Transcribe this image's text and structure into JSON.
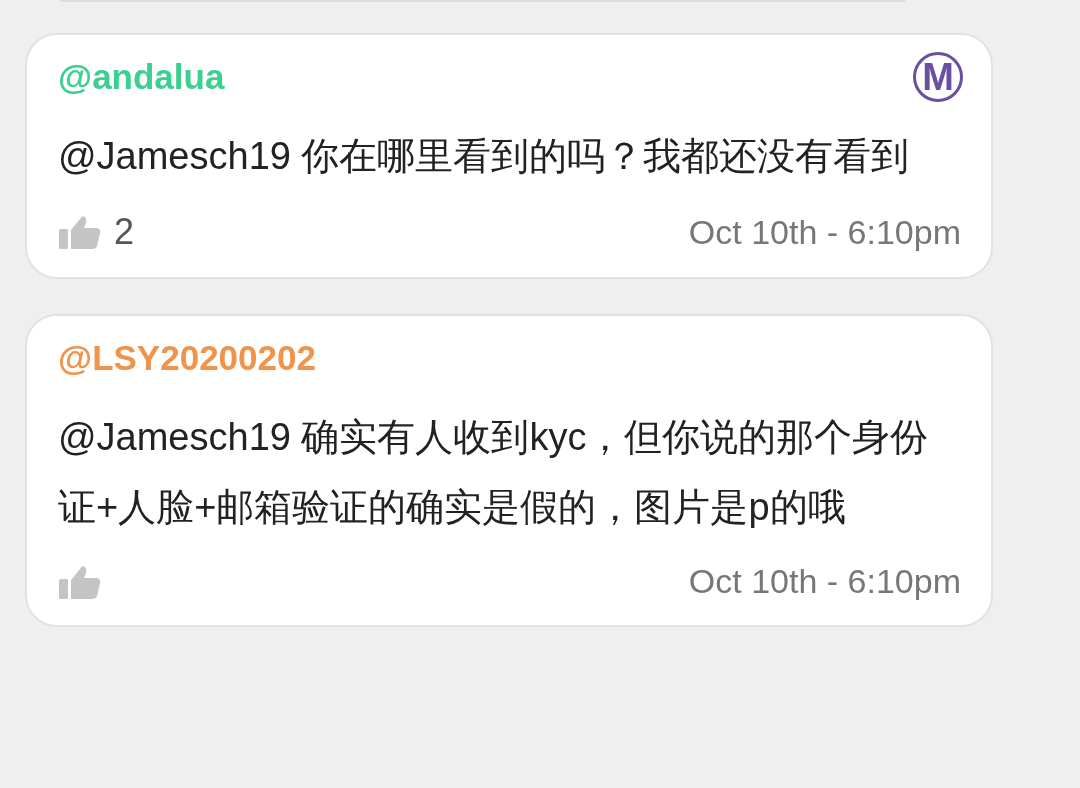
{
  "comments": [
    {
      "username": "@andalua",
      "color": "#3ccf8f",
      "badge": "M",
      "text": "@Jamesch19 你在哪里看到的吗？我都还没有看到",
      "likes": "2",
      "timestamp": "Oct 10th - 6:10pm"
    },
    {
      "username": "@LSY20200202",
      "color": "#f0944c",
      "text": "@Jamesch19 确实有人收到kyc，但你说的那个身份证+人脸+邮箱验证的确实是假的，图片是p的哦",
      "timestamp": "Oct 10th - 6:10pm"
    }
  ]
}
